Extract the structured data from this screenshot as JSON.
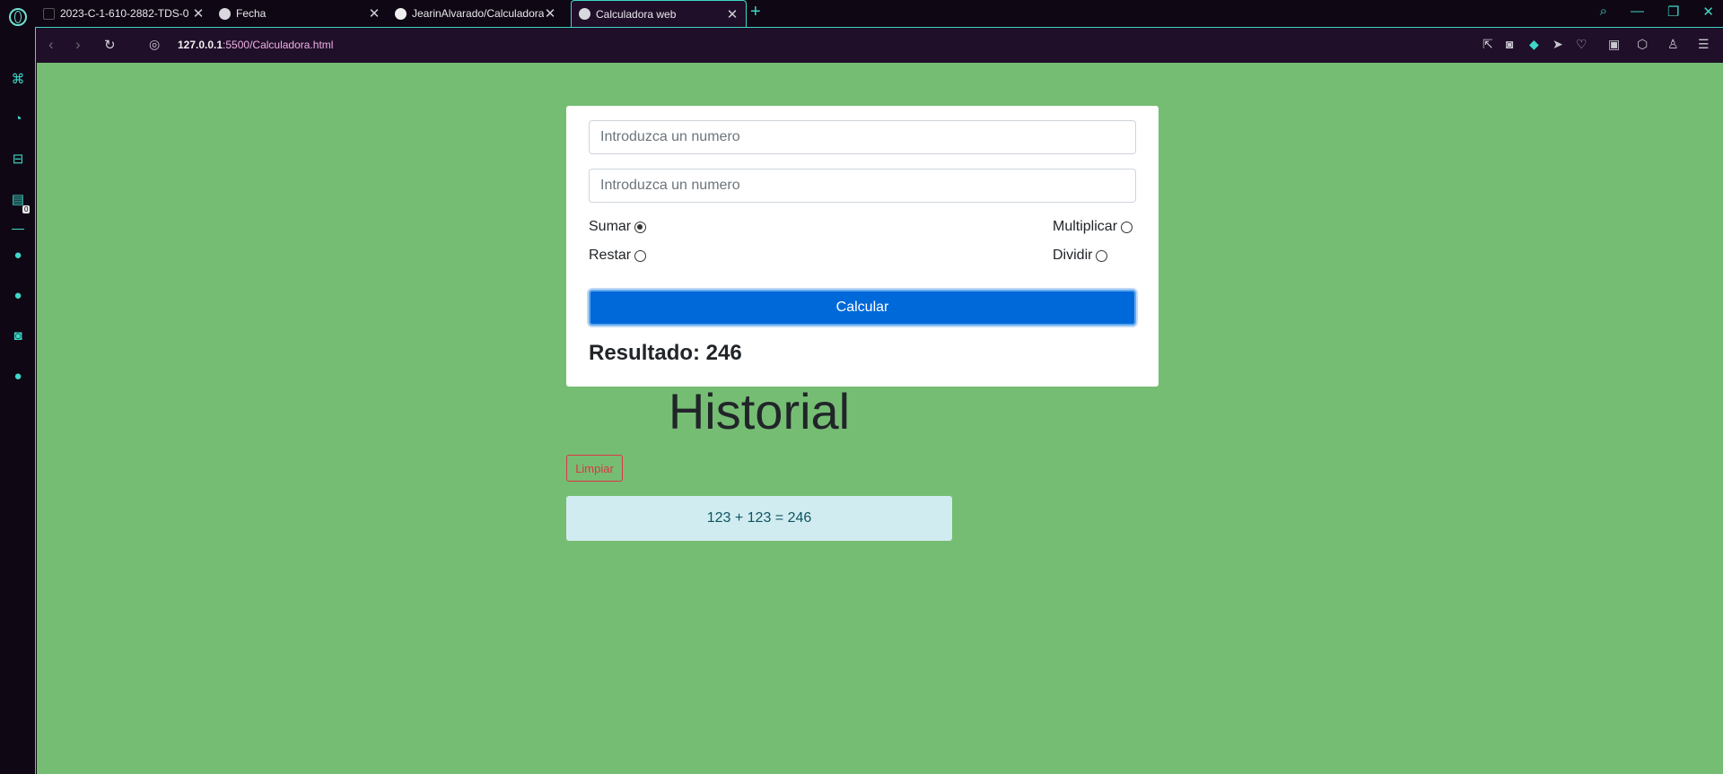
{
  "browser": {
    "tabs": [
      {
        "label": "2023-C-1-610-2882-TDS-0",
        "favicon": "document-icon",
        "active": false
      },
      {
        "label": "Fecha",
        "favicon": "globe-icon",
        "active": false
      },
      {
        "label": "JearinAlvarado/Calculadora",
        "favicon": "github-icon",
        "active": false
      },
      {
        "label": "Calculadora web",
        "favicon": "globe-icon",
        "active": true
      }
    ],
    "new_tab_label": "+",
    "close_glyph": "✕",
    "url_host": "127.0.0.1",
    "url_rest": ":5500/Calculadora.html",
    "sidebar_badge": "0",
    "accent_color": "#3ed7c6"
  },
  "calculator": {
    "input1_placeholder": "Introduzca un numero",
    "input2_placeholder": "Introduzca un numero",
    "options": {
      "sumar": "Sumar",
      "restar": "Restar",
      "multiplicar": "Multiplicar",
      "dividir": "Dividir"
    },
    "selected_option": "Sumar",
    "button_label": "Calcular",
    "result_text": "Resultado: 246"
  },
  "history": {
    "title": "Historial",
    "clear_label": "Limpiar",
    "items": [
      "123 + 123 = 246"
    ]
  },
  "colors": {
    "page_background": "#76bd74",
    "primary_button": "#0069d9",
    "danger": "#dc3545",
    "history_item_bg": "#d1ecf1"
  }
}
